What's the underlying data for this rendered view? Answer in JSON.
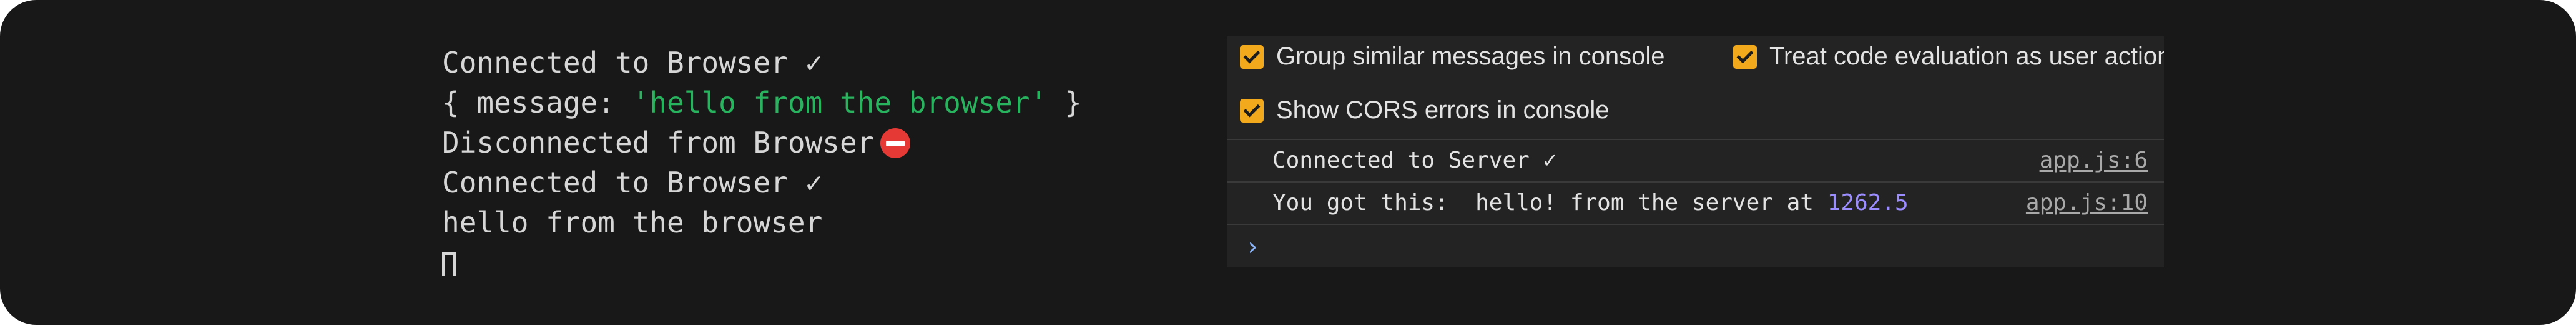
{
  "terminal": {
    "lines": [
      "Connected to Browser ✓",
      {
        "prefix": "{ message: ",
        "string": "'hello from the browser'",
        "suffix": " }"
      },
      "Disconnected from Browser",
      "Connected to Browser ✓",
      "hello from the browser"
    ],
    "icons": {
      "disconnect": "no-entry-icon",
      "cursor": "cursor-icon"
    },
    "colors": {
      "text": "#d6d6d6",
      "string": "#28b35e",
      "no_entry": "#e53935"
    }
  },
  "devtools_console": {
    "settings": [
      {
        "label": "Group similar messages in console",
        "checked": true
      },
      {
        "label": "Treat code evaluation as user action",
        "checked": true
      },
      {
        "label": "Show CORS errors in console",
        "checked": true
      }
    ],
    "messages": [
      {
        "text": "Connected to Server ✓",
        "source": "app.js:6"
      },
      {
        "text": "You got this:  hello! from the server at ",
        "number": "1262.5",
        "source": "app.js:10"
      }
    ],
    "prompt_icon": "chevron-right-icon",
    "colors": {
      "checkbox": "#f2a91c",
      "number": "#9b8cff",
      "prompt": "#8ab4f8"
    }
  }
}
